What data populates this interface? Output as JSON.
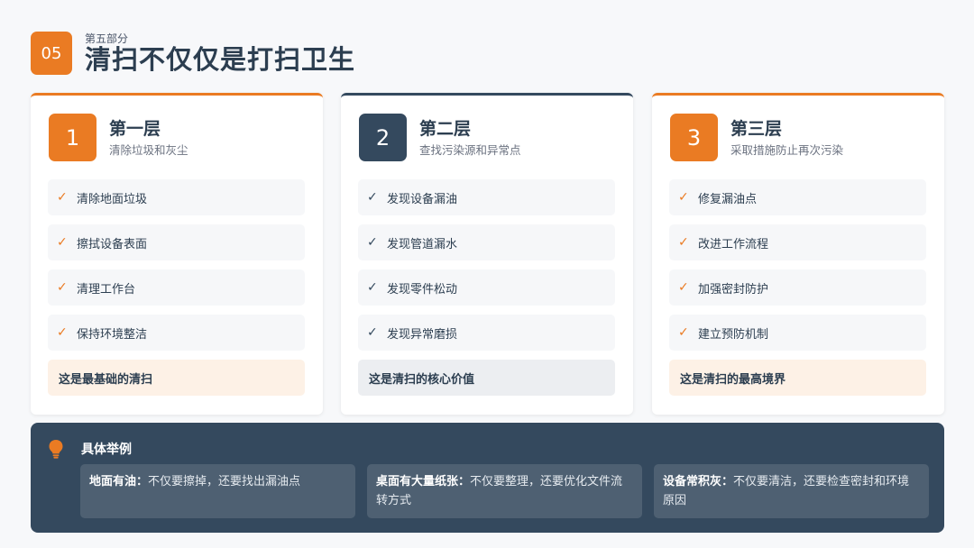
{
  "header": {
    "section_number": "05",
    "eyebrow": "第五部分",
    "title": "清扫不仅仅是打扫卫生"
  },
  "layers": [
    {
      "number": "1",
      "title": "第一层",
      "subtitle": "清除垃圾和灰尘",
      "items": [
        "清除地面垃圾",
        "擦拭设备表面",
        "清理工作台",
        "保持环境整洁"
      ],
      "summary": "这是最基础的清扫"
    },
    {
      "number": "2",
      "title": "第二层",
      "subtitle": "查找污染源和异常点",
      "items": [
        "发现设备漏油",
        "发现管道漏水",
        "发现零件松动",
        "发现异常磨损"
      ],
      "summary": "这是清扫的核心价值"
    },
    {
      "number": "3",
      "title": "第三层",
      "subtitle": "采取措施防止再次污染",
      "items": [
        "修复漏油点",
        "改进工作流程",
        "加强密封防护",
        "建立预防机制"
      ],
      "summary": "这是清扫的最高境界"
    }
  ],
  "examples": {
    "title": "具体举例",
    "icon": "lightbulb-icon",
    "items": [
      {
        "key": "地面有油：",
        "text": "不仅要擦掉，还要找出漏油点"
      },
      {
        "key": "桌面有大量纸张：",
        "text": "不仅要整理，还要优化文件流转方式"
      },
      {
        "key": "设备常积灰：",
        "text": "不仅要清洁，还要检查密封和环境原因"
      }
    ]
  },
  "colors": {
    "accent_orange": "#ea7b23",
    "dark_slate": "#34495e",
    "background": "#f7f8fa"
  }
}
